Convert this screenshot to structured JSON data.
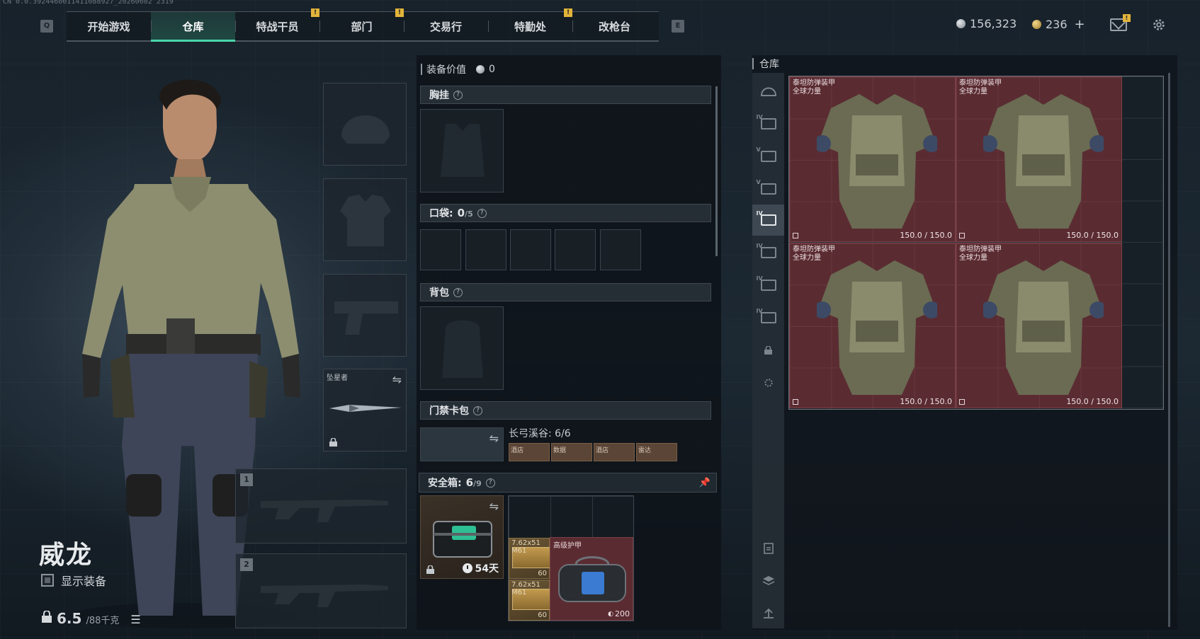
{
  "build_id": "CN 0.0.3924460011411088927_20260602 2319",
  "nav": {
    "key_left": "Q",
    "key_right": "E",
    "tabs": [
      {
        "label": "开始游戏",
        "alert": ""
      },
      {
        "label": "仓库",
        "alert": ""
      },
      {
        "label": "特战干员",
        "alert": "!"
      },
      {
        "label": "部门",
        "alert": "!"
      },
      {
        "label": "交易行",
        "alert": ""
      },
      {
        "label": "特勤处",
        "alert": "!"
      },
      {
        "label": "改枪台",
        "alert": ""
      }
    ],
    "active_tab": "仓库"
  },
  "header": {
    "silver_amount": "156,323",
    "gold_amount": "236",
    "plus_label": "+",
    "mail_badge": "!"
  },
  "character": {
    "name": "威龙",
    "show_equipment_label": "显示装备",
    "weight_value": "6.5",
    "weight_capacity": "/88千克"
  },
  "gear_slots": {
    "melee_label": "坠星者",
    "primary_number": "1",
    "secondary_number": "2"
  },
  "equipment": {
    "value_label": "装备价值",
    "value_amount": "0",
    "chest_rig_label": "胸挂",
    "pockets_label": "口袋:",
    "pockets_used": "0",
    "pockets_total": "/5",
    "backpack_label": "背包",
    "keycard_label": "门禁卡包",
    "keycard_zone": "长弓溪谷: 6/6",
    "keycards": [
      "酒店",
      "数据",
      "酒店",
      "雷达"
    ],
    "help_glyph": "?"
  },
  "safe_box": {
    "label": "安全箱:",
    "used": "6",
    "total": "/9",
    "days": "54天",
    "items": [
      {
        "name": "7.62x51",
        "sub": "M61",
        "count": "60"
      },
      {
        "name": "7.62x51",
        "sub": "M61",
        "count": "60"
      }
    ],
    "armor_item_label": "高级护甲",
    "armor_item_durability": "200"
  },
  "warehouse": {
    "title": "仓库",
    "items": [
      {
        "name": "泰坦防弹装甲",
        "sub": "全球力量",
        "durability": "150.0 / 150.0"
      },
      {
        "name": "泰坦防弹装甲",
        "sub": "全球力量",
        "durability": "150.0 / 150.0"
      },
      {
        "name": "泰坦防弹装甲",
        "sub": "全球力量",
        "durability": "150.0 / 150.0"
      },
      {
        "name": "泰坦防弹装甲",
        "sub": "全球力量",
        "durability": "150.0 / 150.0"
      }
    ],
    "side_tiers": [
      "IV",
      "V",
      "V",
      "IV",
      "IV",
      "IV",
      "IV"
    ]
  }
}
